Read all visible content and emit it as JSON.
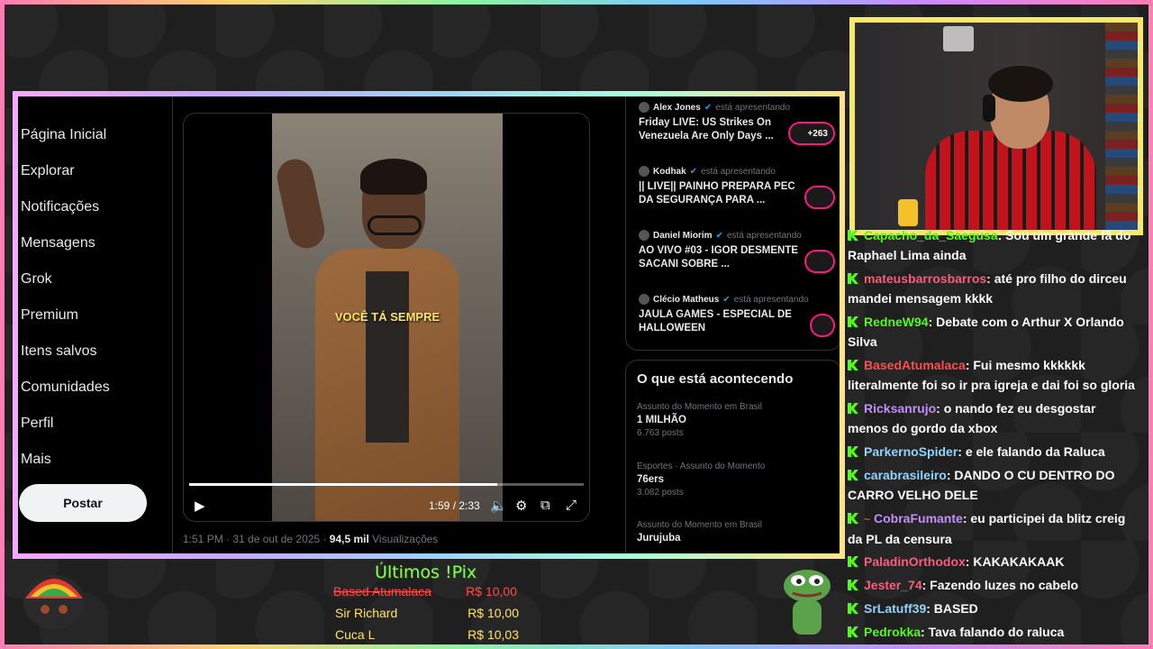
{
  "sidebar": {
    "items": [
      "Página Inicial",
      "Explorar",
      "Notificações",
      "Mensagens",
      "Grok",
      "Premium",
      "Itens salvos",
      "Comunidades",
      "Perfil",
      "Mais"
    ],
    "post_button": "Postar"
  },
  "video": {
    "caption": "VOCÊ TÁ SEMPRE",
    "time": "1:59 / 2:33",
    "progress": 0.78
  },
  "post_meta": {
    "date": "1:51 PM · 31 de out de 2025 · ",
    "views": "94,5 mil",
    "views_label": " Visualizações"
  },
  "live": [
    {
      "user": "Alex Jones",
      "status": "está apresentando",
      "title": "Friday LIVE: US Strikes On Venezuela Are Only Days ...",
      "pill": "+263"
    },
    {
      "user": "Kodhak",
      "status": "está apresentando",
      "title": "|| LIVE|| PAINHO PREPARA PEC DA SEGURANÇA PARA ...",
      "pill": ""
    },
    {
      "user": "Daniel Miorim",
      "status": "está apresentando",
      "title": "AO VIVO #03 - IGOR DESMENTE SACANI SOBRE ...",
      "pill": ""
    },
    {
      "user": "Clécio Matheus",
      "status": "está apresentando",
      "title": "JAULA GAMES - ESPECIAL DE HALLOWEEN",
      "pill": ""
    }
  ],
  "trends": {
    "title": "O que está acontecendo",
    "items": [
      {
        "context": "Assunto do Momento em Brasil",
        "name": "1 MILHÃO",
        "count": "6.763 posts"
      },
      {
        "context": "Esportes · Assunto do Momento",
        "name": "76ers",
        "count": "3.082 posts"
      },
      {
        "context": "Assunto do Momento em Brasil",
        "name": "Jurujuba",
        "count": ""
      }
    ]
  },
  "chat": [
    {
      "user": "Capacho_da_Saegusa",
      "color": "#53fc18",
      "text": ": Sou um grande fã do Raphael Lima ainda"
    },
    {
      "user": "mateusbarrosbarros",
      "color": "#ff5a7a",
      "text": ": até pro filho do dirceu mandei mensagem kkkk"
    },
    {
      "user": "RedneW94",
      "color": "#53fc18",
      "text": ": Debate com o Arthur X Orlando Silva"
    },
    {
      "user": "BasedAtumalaca",
      "color": "#ff4d4d",
      "text": ": Fui mesmo kkkkkk literalmente foi so ir pra igreja e dai foi so gloria"
    },
    {
      "user": "Ricksanrujo",
      "color": "#c58cff",
      "text": ": o nando fez eu desgostar menos do gordo da xbox"
    },
    {
      "user": "ParkernoSpider",
      "color": "#8fd3ff",
      "text": ": e ele falando da Raluca"
    },
    {
      "user": "carabrasileiro",
      "color": "#8fd3ff",
      "text": ": DANDO O CU DENTRO DO CARRO VELHO DELE"
    },
    {
      "user": "CobraFumante",
      "color": "#c58cff",
      "text": ": eu participei da blitz creig da PL da censura"
    },
    {
      "user": "PaladinOrthodox",
      "color": "#ff5a7a",
      "text": ": KAKAKAKAAK"
    },
    {
      "user": "Jester_74",
      "color": "#ff5a7a",
      "text": ": Fazendo luzes no cabelo"
    },
    {
      "user": "SrLatuff39",
      "color": "#8fd3ff",
      "text": ": BASED"
    },
    {
      "user": "Pedrokka",
      "color": "#53fc18",
      "text": ": Tava falando do raluca"
    }
  ],
  "pix": {
    "title": "Últimos !Pix",
    "rows": [
      {
        "name": "Based Atumalaca",
        "amount": "R$ 10,00"
      },
      {
        "name": "Sir Richard",
        "amount": "R$ 10,00"
      },
      {
        "name": "Cuca L",
        "amount": "R$ 10,03"
      }
    ]
  }
}
